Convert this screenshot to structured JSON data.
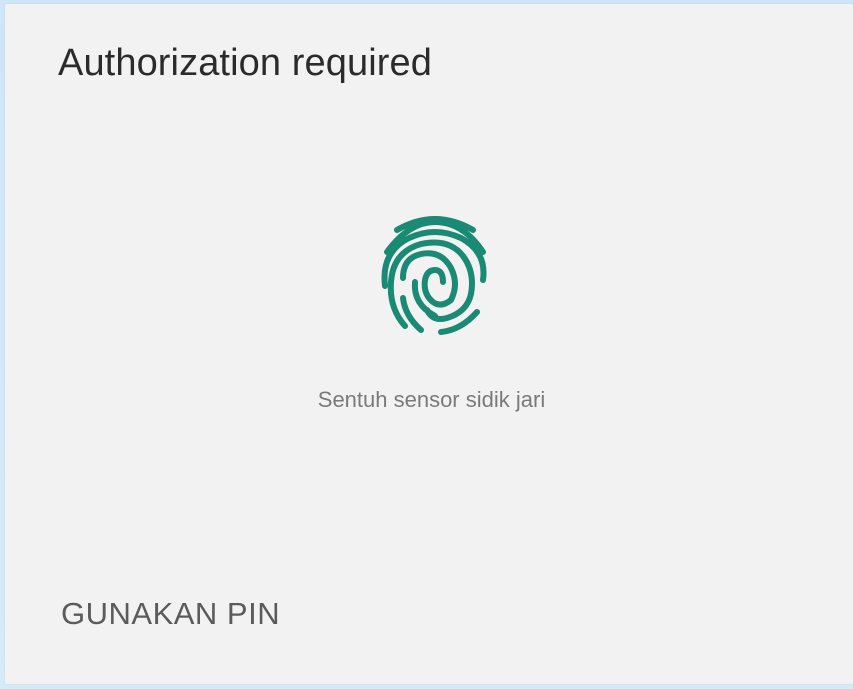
{
  "dialog": {
    "title": "Authorization required",
    "hint": "Sentuh sensor sidik jari",
    "pin_button_label": "GUNAKAN PIN",
    "icon": "fingerprint-icon"
  },
  "colors": {
    "accent": "#1a8a74",
    "dialog_background": "#f2f2f2",
    "backdrop": "#d3e8f7"
  }
}
